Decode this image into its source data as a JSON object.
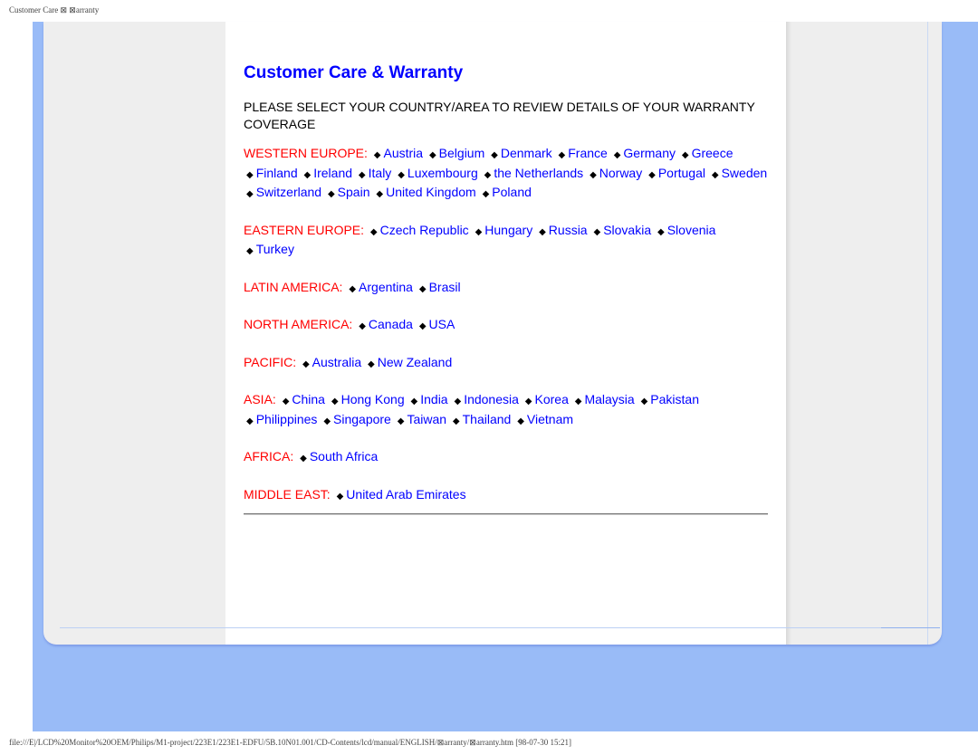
{
  "browser": {
    "page_header": "Customer Care ⊠ ⊠arranty",
    "footer_path": "file:///E|/LCD%20Monitor%20OEM/Philips/M1-project/223E1/223E1-EDFU/5B.10N01.001/CD-Contents/lcd/manual/ENGLISH/⊠arranty/⊠arranty.htm [98-07-30 15:21]"
  },
  "main": {
    "title": "Customer Care & Warranty",
    "intro": "PLEASE SELECT YOUR COUNTRY/AREA TO REVIEW DETAILS OF YOUR WARRANTY COVERAGE",
    "bullet_glyph": "◆",
    "regions": [
      {
        "label": "WESTERN EUROPE:",
        "countries": [
          "Austria",
          "Belgium",
          "Denmark",
          "France",
          "Germany",
          "Greece",
          "Finland",
          "Ireland",
          "Italy",
          "Luxembourg",
          "the Netherlands",
          "Norway",
          "Portugal",
          "Sweden",
          "Switzerland",
          "Spain",
          "United Kingdom",
          "Poland"
        ]
      },
      {
        "label": "EASTERN EUROPE:",
        "countries": [
          "Czech Republic",
          "Hungary",
          "Russia",
          "Slovakia",
          "Slovenia",
          "Turkey"
        ]
      },
      {
        "label": "LATIN AMERICA:",
        "countries": [
          "Argentina",
          "Brasil"
        ]
      },
      {
        "label": "NORTH AMERICA:",
        "countries": [
          "Canada",
          "USA"
        ]
      },
      {
        "label": "PACIFIC:",
        "countries": [
          "Australia",
          "New Zealand"
        ]
      },
      {
        "label": "ASIA:",
        "countries": [
          "China",
          "Hong Kong",
          "India",
          "Indonesia",
          "Korea",
          "Malaysia",
          "Pakistan",
          "Philippines",
          "Singapore",
          "Taiwan",
          "Thailand",
          "Vietnam"
        ]
      },
      {
        "label": "AFRICA:",
        "countries": [
          "South Africa"
        ]
      },
      {
        "label": "MIDDLE EAST:",
        "countries": [
          "United Arab Emirates"
        ]
      }
    ]
  },
  "colors": {
    "title": "#0000ff",
    "region_label": "#ff0000",
    "link": "#0000ff",
    "background_blue": "#99bbf7",
    "panel_gray": "#eeeeee"
  }
}
